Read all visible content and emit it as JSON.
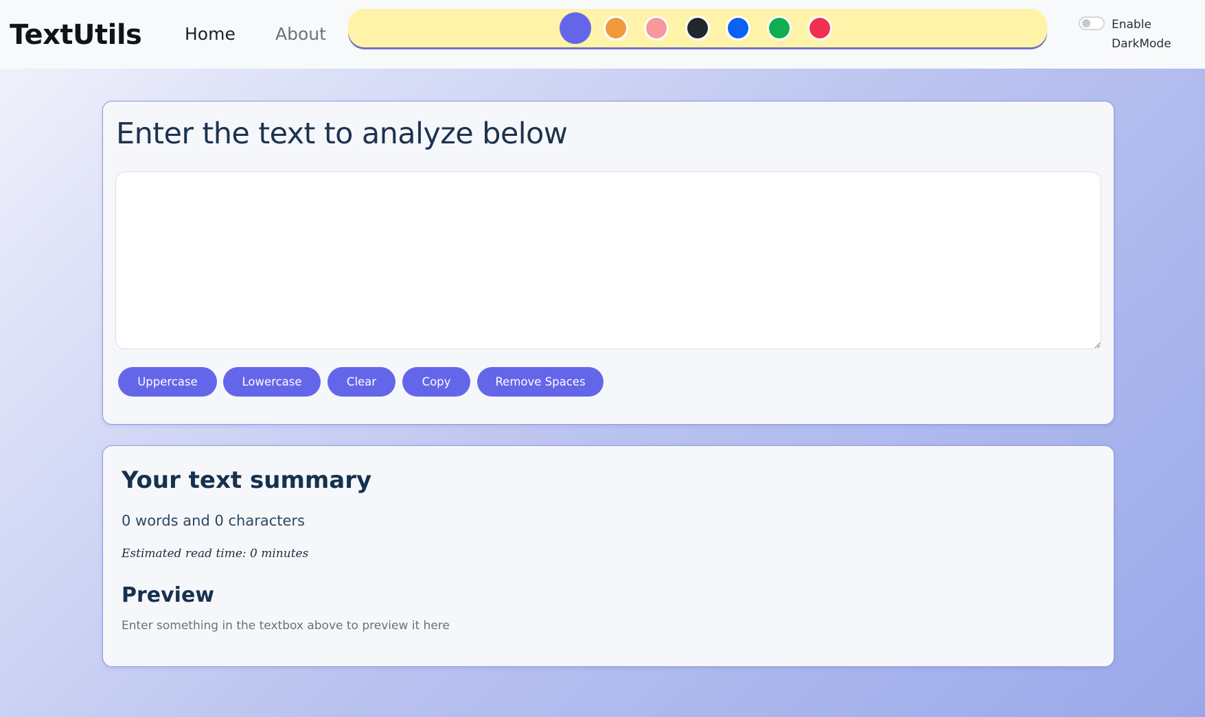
{
  "navbar": {
    "brand": "TextUtils",
    "links": [
      {
        "label": "Home"
      },
      {
        "label": "About"
      }
    ],
    "theme_colors": [
      {
        "name": "indigo",
        "color": "#6466ea",
        "active": true
      },
      {
        "name": "orange",
        "color": "#f2993e",
        "active": false
      },
      {
        "name": "pink",
        "color": "#f7999a",
        "active": false
      },
      {
        "name": "dark",
        "color": "#22272d",
        "active": false
      },
      {
        "name": "blue",
        "color": "#0a61f2",
        "active": false
      },
      {
        "name": "green",
        "color": "#0fae4f",
        "active": false
      },
      {
        "name": "red",
        "color": "#f2304f",
        "active": false
      }
    ],
    "dark_mode": {
      "label": "Enable DarkMode",
      "enabled": false
    }
  },
  "input_card": {
    "heading": "Enter the text to analyze below",
    "textarea_value": "",
    "buttons": {
      "uppercase": "Uppercase",
      "lowercase": "Lowercase",
      "clear": "Clear",
      "copy": "Copy",
      "remove_spaces": "Remove Spaces"
    }
  },
  "summary_card": {
    "heading": "Your text summary",
    "counts": "0 words and 0 characters",
    "read_time": "Estimated read time: 0 minutes",
    "preview_heading": "Preview",
    "preview_text": "Enter something in the textbox above to preview it here"
  },
  "colors": {
    "accent": "#6466ea",
    "color_bar_bg": "#fef3a8",
    "card_border": "#8f97e4",
    "heading_text": "#16314f"
  }
}
